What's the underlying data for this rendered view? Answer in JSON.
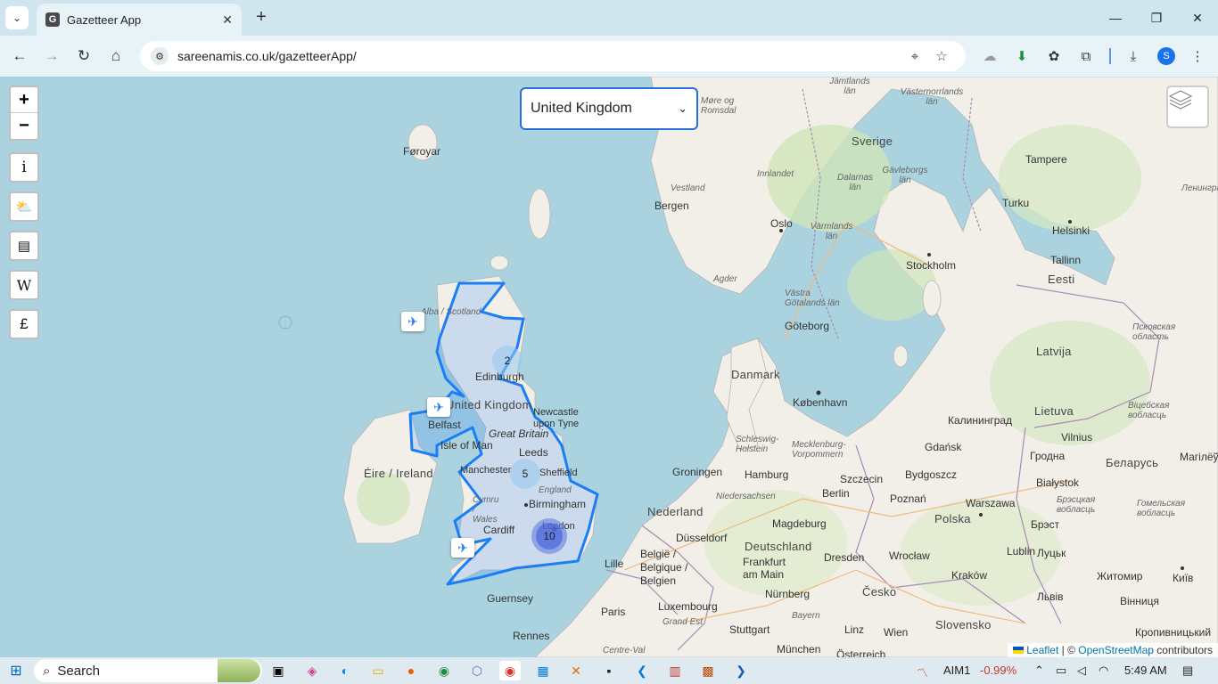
{
  "browser": {
    "tab_title": "Gazetteer App",
    "tab_favicon": "G",
    "url": "sareenamis.co.uk/gazetteerApp/",
    "profile_initial": "S"
  },
  "map": {
    "selected_country": "United Kingdom",
    "zoom_in": "+",
    "zoom_out": "−",
    "info_label": "i",
    "wiki_label": "W",
    "currency_label": "£",
    "attribution_leaflet": "Leaflet",
    "attribution_sep": " | © ",
    "attribution_osm": "OpenStreetMap",
    "attribution_tail": " contributors",
    "clusters": [
      {
        "count": "2"
      },
      {
        "count": "5"
      },
      {
        "count": "10"
      }
    ],
    "labels": {
      "faroe": "Føroyar",
      "scotland": "Alba / Scotland",
      "edinburgh": "Edinburgh",
      "uk": "United Kingdom",
      "belfast": "Belfast",
      "newcastle": "Newcastle upon Tyne",
      "great_britain": "Great Britain",
      "isle_of_man": "Isle of Man",
      "leeds": "Leeds",
      "manchester": "Manchester",
      "sheffield": "Sheffield",
      "eire": "Éire / Ireland",
      "england": "England",
      "cymru": "Cymru / Wales",
      "birmingham": "Birmingham",
      "cardiff": "Cardiff",
      "london": "London",
      "guernsey": "Guernsey",
      "rennes": "Rennes",
      "paris": "Paris",
      "lille": "Lille",
      "belgie": "België / Belgique / Belgien",
      "luxembourg": "Luxembourg",
      "grand_est": "Grand Est",
      "centre_val": "Centre-Val",
      "nederland": "Nederland",
      "groningen": "Groningen",
      "dusseldorf": "Düsseldorf",
      "deutschland": "Deutschland",
      "frankfurt": "Frankfurt am Main",
      "nurnberg": "Nürnberg",
      "stuttgart": "Stuttgart",
      "munchen": "München",
      "bayern": "Bayern",
      "hamburg": "Hamburg",
      "niedersachsen": "Niedersachsen",
      "schleswig": "Schleswig-Holstein",
      "mecklenburg": "Mecklenburg-Vorpommern",
      "berlin": "Berlin",
      "magdeburg": "Magdeburg",
      "dresden": "Dresden",
      "szczecin": "Szczecin",
      "gdansk": "Gdańsk",
      "bydgoszcz": "Bydgoszcz",
      "poznan": "Poznań",
      "polska": "Polska",
      "warszawa": "Warszawa",
      "wroclaw": "Wrocław",
      "krakow": "Kraków",
      "lublin": "Lublin",
      "cesko": "Česko",
      "linz": "Linz",
      "wien": "Wien",
      "osterreich": "Österreich",
      "slovensko": "Slovensko",
      "danmark": "Danmark",
      "kobenhavn": "København",
      "goteborg": "Göteborg",
      "vastra": "Västra Götalands län",
      "sverige": "Sverige",
      "stockholm": "Stockholm",
      "dalarnas": "Dalarnas län",
      "gavleborgs": "Gävleborgs län",
      "varmlands": "Värmlands län",
      "jamtlands": "Jämtlands län",
      "vasternorrlands": "Västernorrlands län",
      "more": "Møre og Romsdal",
      "vestland": "Vestland",
      "innlandet": "Innlandet",
      "bergen": "Bergen",
      "oslo": "Oslo",
      "agder": "Agder",
      "tampere": "Tampere",
      "turku": "Turku",
      "helsinki": "Helsinki",
      "tallinn": "Tallinn",
      "eesti": "Eesti",
      "latvija": "Latvija",
      "lietuva": "Lietuva",
      "vilnius": "Vilnius",
      "kaliningrad": "Калининград",
      "grodno": "Гродна",
      "bialystok": "Białystok",
      "belarus": "Беларусь",
      "brest": "Брэст",
      "brest_obl": "Брэсцкая вобласць",
      "gomel_obl": "Гомельская вобласць",
      "vitebsk_obl": "Віцебская вобласць",
      "pskov_obl": "Псковская область",
      "leningrad": "Ленинградская",
      "mogilev": "Магілёў",
      "lutsk": "Луцьк",
      "zhytomyr": "Житомир",
      "kyiv": "Київ",
      "lviv": "Львів",
      "vinnytsia": "Вінниця",
      "kropyvnytskyi": "Кропивницький"
    }
  },
  "taskbar": {
    "search_placeholder": "Search",
    "stock_name": "AIM1",
    "stock_change": "-0.99%",
    "time": "5:49 AM"
  }
}
